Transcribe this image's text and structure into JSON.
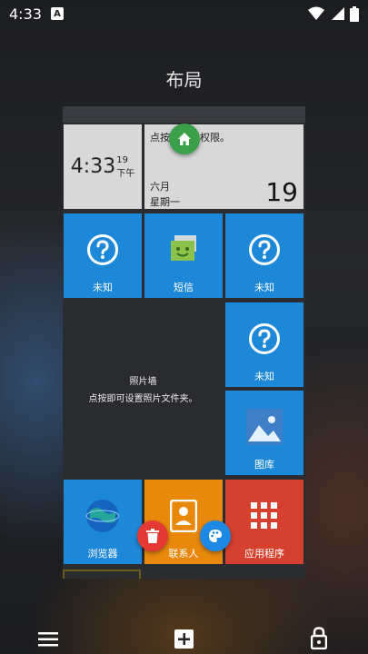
{
  "status": {
    "time": "4:33",
    "notification_letter": "A"
  },
  "page_title": "布局",
  "tiles": {
    "clock": {
      "time": "4:33",
      "seconds": "19",
      "ampm": "下午"
    },
    "calendar": {
      "hint": "点按以授予权限。",
      "month": "六月",
      "weekday": "星期一",
      "day": "19"
    },
    "unknown_1": {
      "label": "未知"
    },
    "sms": {
      "label": "短信"
    },
    "unknown_2": {
      "label": "未知"
    },
    "photo_wall": {
      "title": "照片墙",
      "hint": "点按即可设置照片文件夹。"
    },
    "unknown_3": {
      "label": "未知"
    },
    "gallery": {
      "label": "图库"
    },
    "browser": {
      "label": "浏览器"
    },
    "contacts": {
      "label": "联系人"
    },
    "apps": {
      "label": "应用程序"
    }
  },
  "colors": {
    "tile_blue": "#1e88d8",
    "tile_orange": "#e8890c",
    "tile_red": "#d6402f",
    "home_fab": "#3aa04a",
    "delete_fab": "#e53935",
    "palette_fab": "#1e88e5"
  },
  "icons": {
    "menu": "hamburger-icon",
    "add": "plus-box-icon",
    "lock": "lock-icon"
  }
}
